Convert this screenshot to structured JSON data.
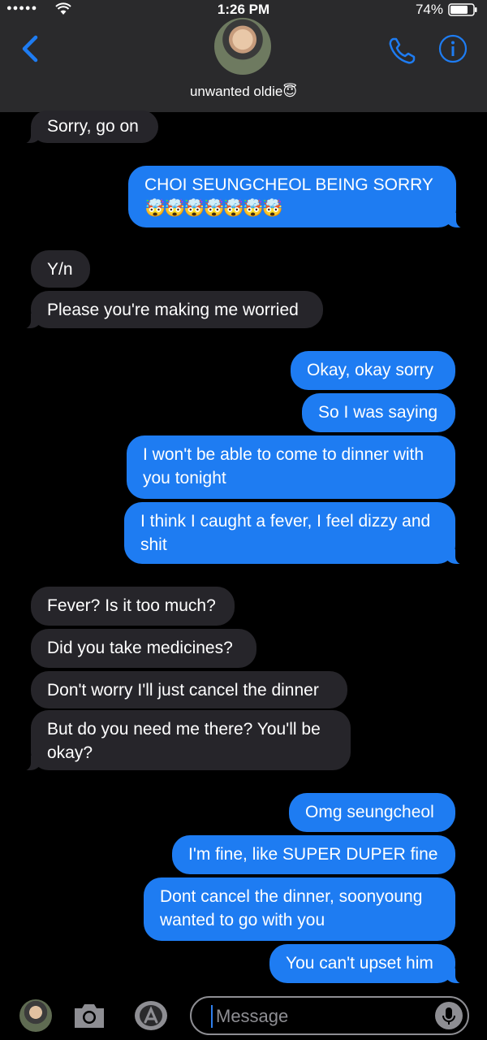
{
  "status_bar": {
    "signal": "●●●●●",
    "time": "1:26 PM",
    "battery": "74%"
  },
  "header": {
    "contact_name": "unwanted oldie😇",
    "back_icon": "chevron-left-icon",
    "call_icon": "phone-icon",
    "info_icon": "info-icon",
    "accent_color": "#1e7cf2"
  },
  "messages": [
    {
      "from": "them",
      "text": "Sorry, go on"
    },
    {
      "from": "me",
      "text": "CHOI SEUNGCHEOL BEING SORRY",
      "emoji": "🤯🤯🤯🤯🤯🤯🤯"
    },
    {
      "from": "them",
      "text": "Y/n"
    },
    {
      "from": "them",
      "text": "Please you're making me worried"
    },
    {
      "from": "me",
      "text": "Okay, okay sorry"
    },
    {
      "from": "me",
      "text": "So I was saying"
    },
    {
      "from": "me",
      "text": "I won't be able to come to dinner with you tonight"
    },
    {
      "from": "me",
      "text": "I think I caught a fever, I feel dizzy and shit"
    },
    {
      "from": "them",
      "text": "Fever? Is it too much?"
    },
    {
      "from": "them",
      "text": "Did you take medicines?"
    },
    {
      "from": "them",
      "text": "Don't worry I'll just cancel the dinner"
    },
    {
      "from": "them",
      "text": "But do you need me there? You'll be okay?"
    },
    {
      "from": "me",
      "text": "Omg seungcheol"
    },
    {
      "from": "me",
      "text": "I'm fine, like SUPER DUPER fine"
    },
    {
      "from": "me",
      "text": "Dont cancel the dinner, soonyoung wanted to go with you"
    },
    {
      "from": "me",
      "text": "You can't upset him"
    }
  ],
  "input_bar": {
    "placeholder": "Message",
    "camera_icon": "camera-icon",
    "appstore_icon": "app-store-icon",
    "mic_icon": "microphone-icon"
  }
}
